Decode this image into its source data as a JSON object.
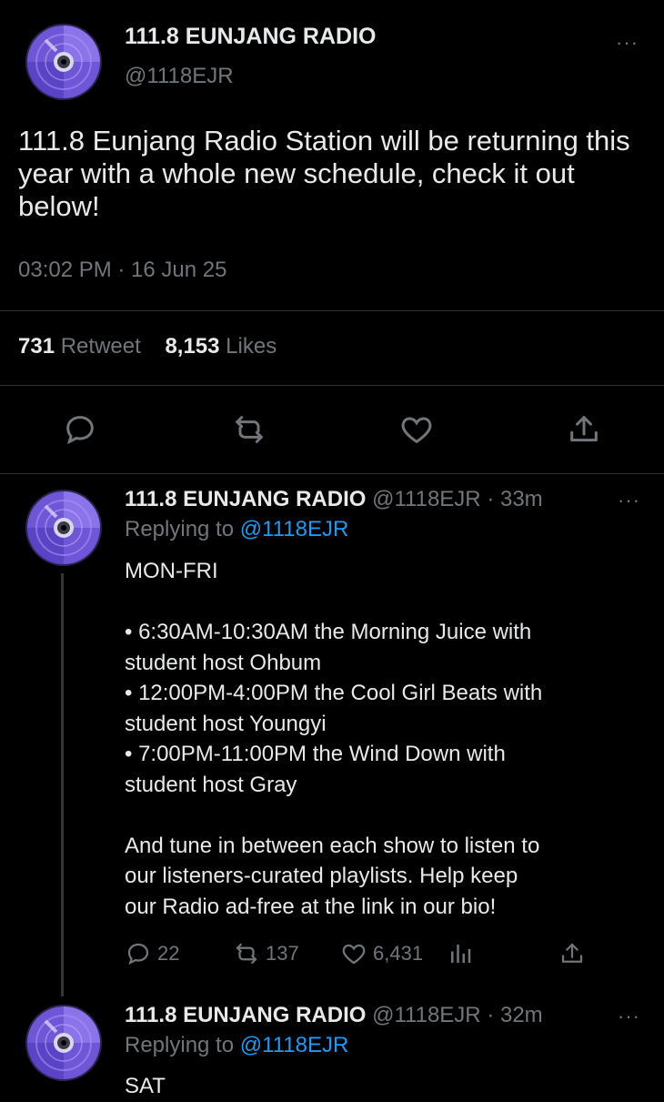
{
  "main_tweet": {
    "display_name": "111.8 EUNJANG RADIO",
    "handle": "@1118EJR",
    "more": "···",
    "text": "111.8 Eunjang Radio Station will be returning this year with a whole new schedule, check it out below!",
    "timestamp": "03:02 PM · 16 Jun 25",
    "retweet_count": "731",
    "retweet_label": "Retweet",
    "likes_count": "8,153",
    "likes_label": "Likes",
    "actions": [
      "reply-icon",
      "retweet-icon",
      "heart-icon",
      "share-icon"
    ]
  },
  "replies": [
    {
      "display_name": "111.8 EUNJANG RADIO",
      "handle": "@1118EJR",
      "age": "· 33m",
      "more": "···",
      "replying_label": "Replying to",
      "replying_to": "@1118EJR",
      "lines": [
        "MON-FRI",
        "",
        "• 6:30AM-10:30AM the Morning Juice with",
        "student host Ohbum",
        "• 12:00PM-4:00PM the Cool Girl Beats with",
        "student host Youngyi",
        "• 7:00PM-11:00PM the Wind Down with",
        "student host Gray",
        "",
        "And tune in between each show to listen to",
        "our listeners-curated playlists. Help keep",
        "our Radio ad-free at the link in our bio!"
      ],
      "reply_count": "22",
      "retweet_count": "137",
      "like_count": "6,431"
    },
    {
      "display_name": "111.8 EUNJANG RADIO",
      "handle": "@1118EJR",
      "age": "· 32m",
      "more": "···",
      "replying_label": "Replying to",
      "replying_to": "@1118EJR",
      "lines": [
        "SAT"
      ]
    }
  ],
  "colors": {
    "background": "#000000",
    "text": "#e7e9ea",
    "muted": "#71767b",
    "link": "#1d9bf0",
    "divider": "#2f3336",
    "avatar_purple": "#6b4fd8"
  }
}
